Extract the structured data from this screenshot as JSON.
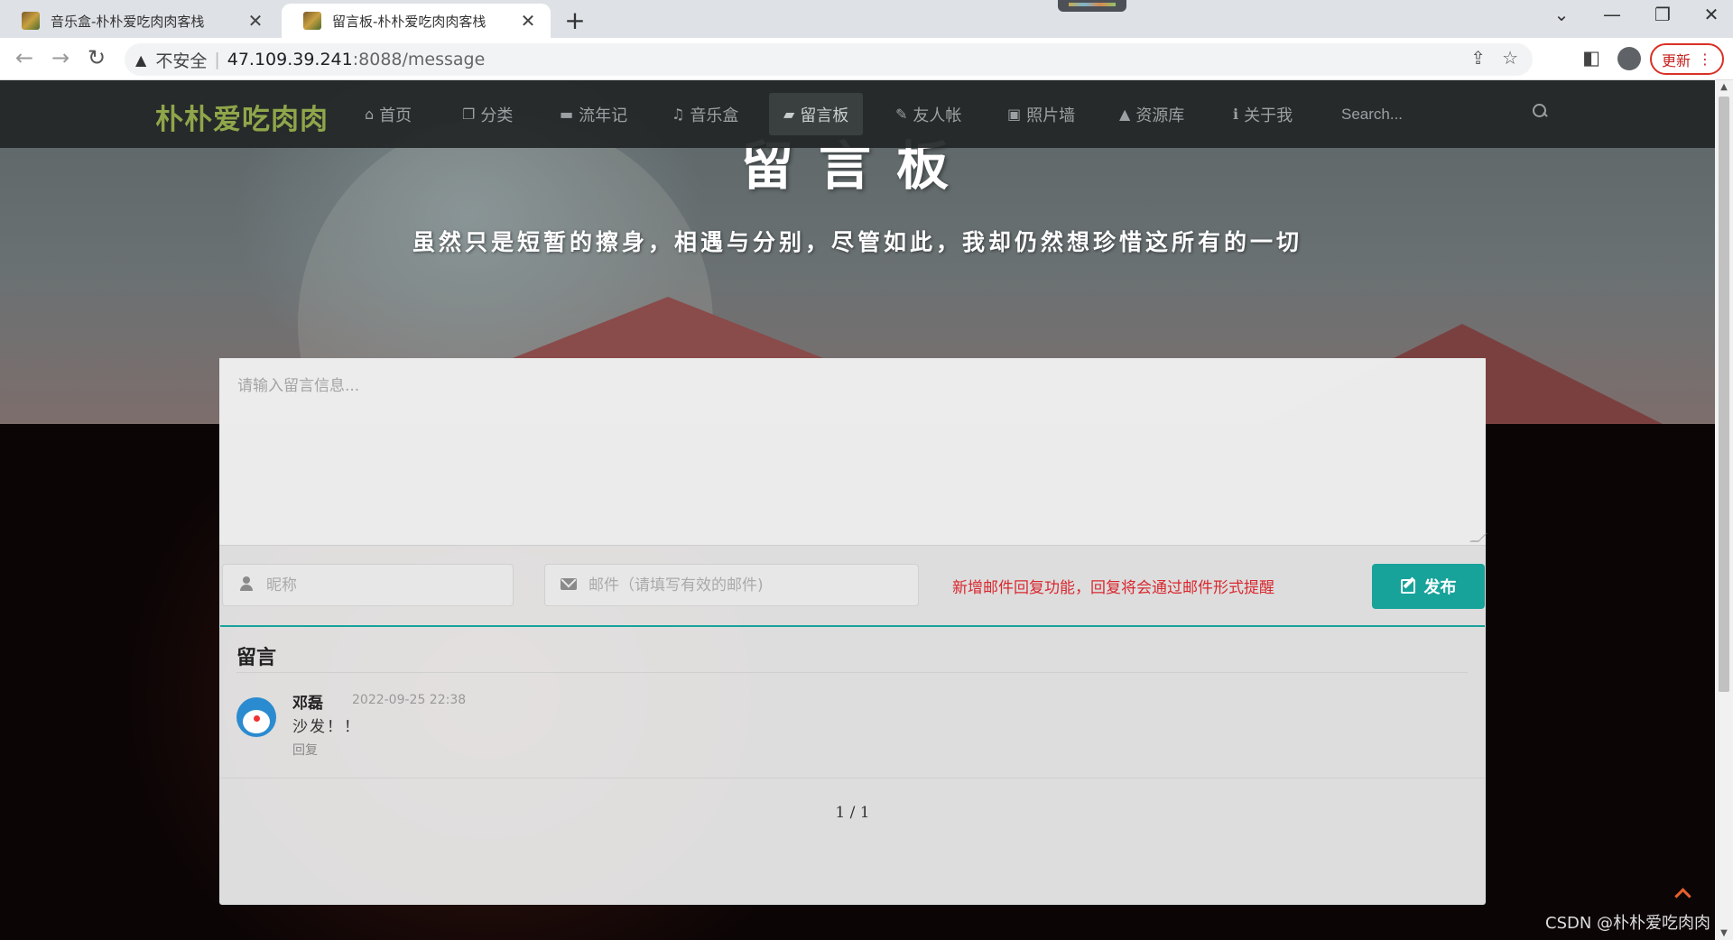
{
  "browser": {
    "tabs": [
      {
        "title": "音乐盒-朴朴爱吃肉肉客栈",
        "active": false
      },
      {
        "title": "留言板-朴朴爱吃肉肉客栈",
        "active": true
      }
    ],
    "new_tab": "+",
    "close_glyph": "✕",
    "window_controls": {
      "dropdown": "⌄",
      "minimize": "—",
      "restore": "❐",
      "close": "✕"
    },
    "nav": {
      "back": "←",
      "forward": "→",
      "reload": "↻"
    },
    "security_label": "不安全",
    "url_host": "47.109.39.241",
    "url_path": ":8088/message",
    "share_icon": "share-icon",
    "star_icon": "star-icon",
    "update_label": "更新",
    "update_menu": "⋮"
  },
  "site": {
    "brand": "朴朴爱吃肉肉",
    "nav": [
      {
        "icon": "home-icon",
        "glyph": "⌂",
        "label": "首页",
        "active": false
      },
      {
        "icon": "copy-icon",
        "glyph": "❐",
        "label": "分类",
        "active": false
      },
      {
        "icon": "archive-icon",
        "glyph": "▬",
        "label": "流年记",
        "active": false
      },
      {
        "icon": "music-icon",
        "glyph": "♫",
        "label": "音乐盒",
        "active": false
      },
      {
        "icon": "book-icon",
        "glyph": "▰",
        "label": "留言板",
        "active": true
      },
      {
        "icon": "pencil-icon",
        "glyph": "✎",
        "label": "友人帐",
        "active": false
      },
      {
        "icon": "image-icon",
        "glyph": "▣",
        "label": "照片墙",
        "active": false
      },
      {
        "icon": "graduation-cap-icon",
        "glyph": "▲",
        "label": "资源库",
        "active": false
      },
      {
        "icon": "info-icon",
        "glyph": "ℹ",
        "label": "关于我",
        "active": false
      }
    ],
    "search_placeholder": "Search...",
    "accent_color": "#17a39a",
    "brand_color": "#8fa64a"
  },
  "hero": {
    "title": "留言板",
    "subtitle": "虽然只是短暂的擦身，相遇与分别，尽管如此，我却仍然想珍惜这所有的一切"
  },
  "form": {
    "message_placeholder": "请输入留言信息...",
    "nickname_placeholder": "昵称",
    "email_placeholder": "邮件（请填写有效的邮件)",
    "notice": "新增邮件回复功能，回复将会通过邮件形式提醒",
    "publish_label": "发布"
  },
  "comments": {
    "heading": "留言",
    "items": [
      {
        "name": "邓磊",
        "time": "2022-09-25 22:38",
        "text": "沙发！！",
        "reply_label": "回复"
      }
    ],
    "pagination": "1 / 1"
  },
  "watermark": "CSDN @朴朴爱吃肉肉"
}
